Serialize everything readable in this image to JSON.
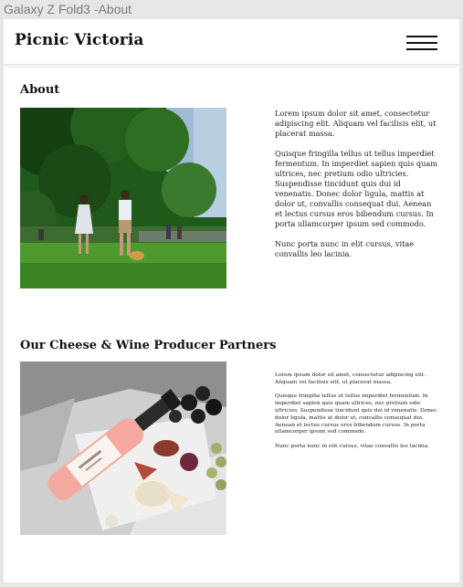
{
  "frame": {
    "device_label": "Galaxy Z Fold3 -About"
  },
  "header": {
    "brand": "Picnic Victoria",
    "menu_icon": "hamburger-menu-icon"
  },
  "about": {
    "title": "About",
    "image": "couple-walking-dog-in-park",
    "paragraphs": [
      "Lorem ipsum dolor sit amet, consectetur adipiscing elit. Aliquam vel facilisis elit, ut placerat massa.",
      "Quisque fringilla tellus ut tellus imperdiet fermentum. In imperdiet sapien quis quam ultrices, nec pretium odio ultricies. Suspendisse tincidunt quis dui id venenatis. Donec dolor ligula, mattis at dolor ut, convallis consequat dui. Aenean et lectus cursus eros bibendum cursus. In porta ullamcorper ipsum sed commodo.",
      "Nunc porta nunc in elit cursus, vitae convallis leo lacinia."
    ]
  },
  "partners": {
    "title": "Our Cheese & Wine Producer Partners",
    "image": "rose-wine-cheese-grapes-figs-picnic",
    "paragraphs": [
      "Lorem ipsum dolor sit amet, consectetur adipiscing elit. Aliquam vel facilisis elit, ut placerat massa.",
      "Quisque fringilla tellus ut tellus imperdiet fermentum. In imperdiet sapien quis quam ultrices, nec pretium odio ultricies. Suspendisse tincidunt quis dui id venenatis. Donec dolor ligula, mattis at dolor ut, convallis consequat dui. Aenean et lectus cursus eros bibendum cursus. In porta ullamcorper ipsum sed commodo.",
      "Nunc porta nunc in elit cursus, vitae convallis leo lacinia."
    ]
  }
}
